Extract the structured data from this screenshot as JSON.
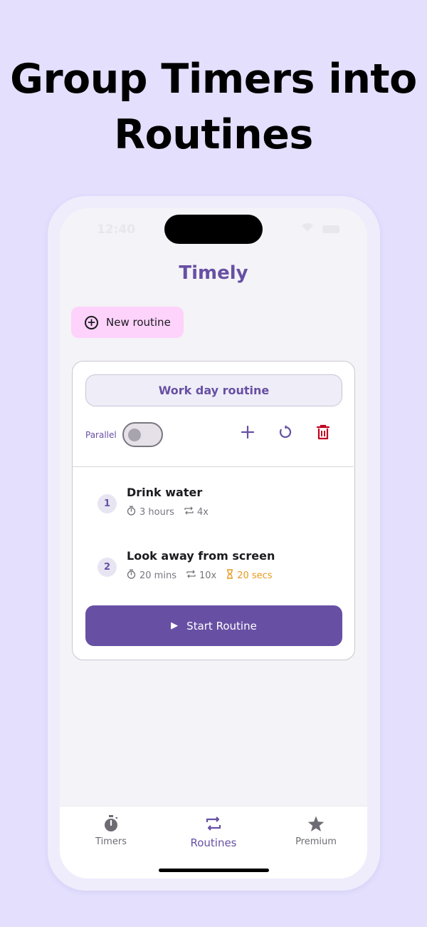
{
  "headline": {
    "line1": "Group Timers into",
    "line2": "Routines"
  },
  "status_bar": {
    "time": "12:40"
  },
  "app": {
    "title": "Timely"
  },
  "new_routine_button": {
    "label": "New routine"
  },
  "routine": {
    "name": "Work day routine",
    "parallel_label": "Parallel",
    "parallel_enabled": false,
    "timers": [
      {
        "index": "1",
        "name": "Drink water",
        "duration": "3 hours",
        "repeat": "4x",
        "interval": ""
      },
      {
        "index": "2",
        "name": "Look away from screen",
        "duration": "20 mins",
        "repeat": "10x",
        "interval": "20 secs"
      }
    ],
    "start_label": "Start Routine"
  },
  "bottom_nav": {
    "items": [
      {
        "label": "Timers",
        "icon": "stopwatch-icon",
        "active": false
      },
      {
        "label": "Routines",
        "icon": "repeat-icon",
        "active": true
      },
      {
        "label": "Premium",
        "icon": "star-icon",
        "active": false
      }
    ]
  },
  "colors": {
    "background": "#e3dffd",
    "primary": "#6750a4",
    "new_routine_bg": "#fdd3fb",
    "delete": "#c00020",
    "interval_warn": "#e8981c"
  }
}
